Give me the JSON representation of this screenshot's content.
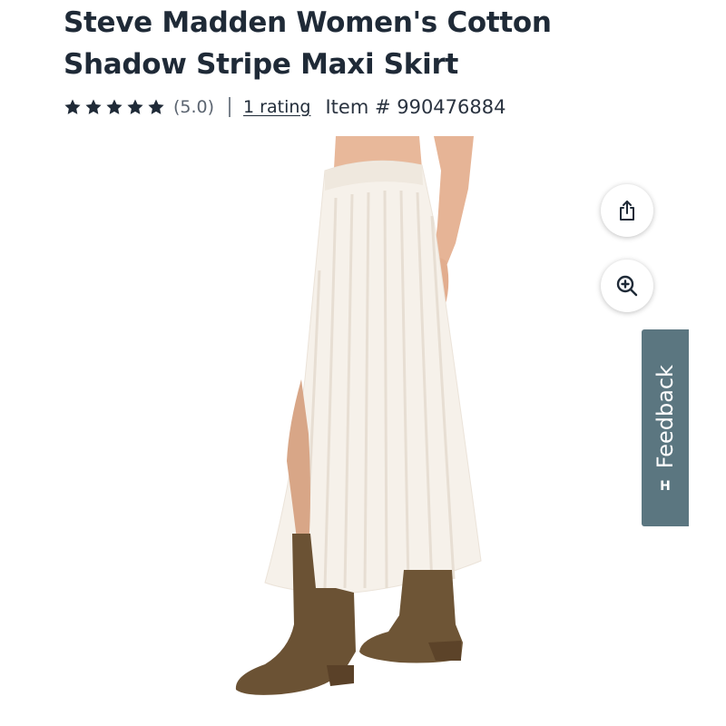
{
  "product": {
    "title_line1": "Steve Madden Women's Cotton",
    "title_line2": "Shadow Stripe Maxi Skirt",
    "rating_score": "(5.0)",
    "stars_filled": 5,
    "rating_count_link": "1 rating",
    "item_number": "Item # 990476884"
  },
  "actions": {
    "share_icon": "share-icon",
    "zoom_icon": "zoom-in-icon"
  },
  "feedback": {
    "label": "Feedback",
    "logo_letter": "H"
  },
  "colors": {
    "text": "#1f2a37",
    "feedback_tab": "#5b7680",
    "skirt": "#f6f1ea",
    "boots": "#6b5234"
  }
}
